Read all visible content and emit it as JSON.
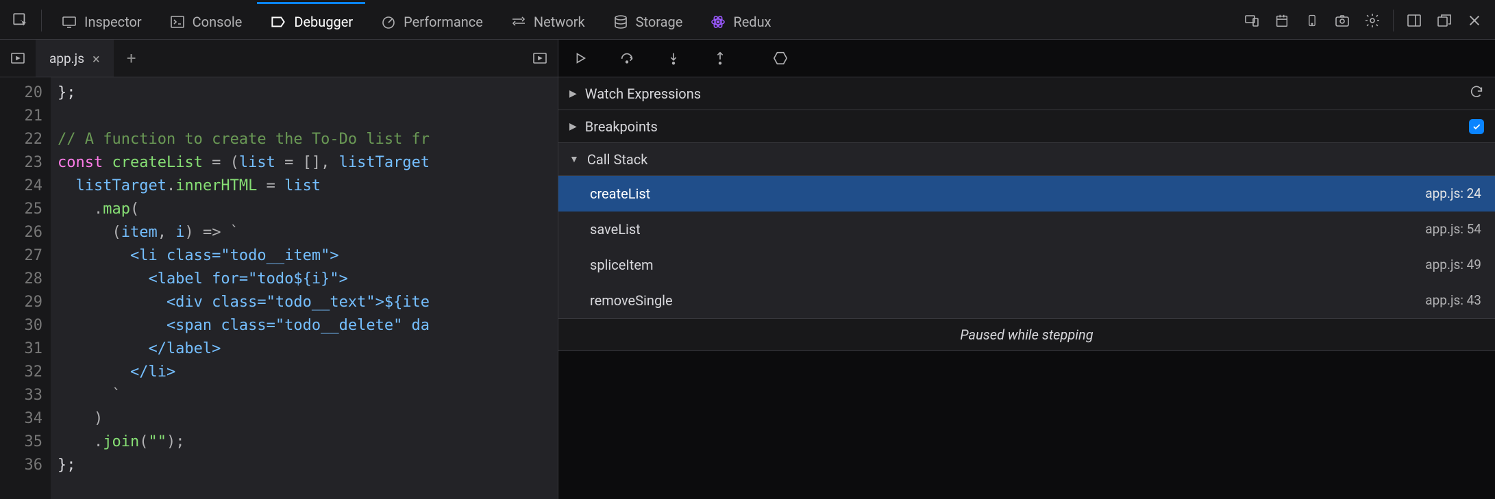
{
  "toolbar": {
    "inspector": "Inspector",
    "console": "Console",
    "debugger": "Debugger",
    "performance": "Performance",
    "network": "Network",
    "storage": "Storage",
    "redux": "Redux"
  },
  "tabs": {
    "file": "app.js"
  },
  "gutter": {
    "start": 20,
    "end": 36
  },
  "code": {
    "l20": "};",
    "l21": "",
    "l22": "// A function to create the To-Do list fr",
    "l23_const": "const ",
    "l23_fn": "createList",
    "l23_eq": " = (",
    "l23_p1": "list",
    "l23_eq2": " = [], ",
    "l23_p2": "listTarget",
    "l24_a": "  ",
    "l24_b": "listTarget",
    "l24_c": ".",
    "l24_d": "innerHTML",
    "l24_e": " = ",
    "l24_f": "list",
    "l25": "    .",
    "l25_fn": "map",
    "l25_b": "(",
    "l26": "      (",
    "l26_i": "item",
    "l26_c": ", ",
    "l26_j": "i",
    "l26_d": ") => `",
    "l27": "        <li class=\"todo__item\">",
    "l28": "          <label for=\"todo${i}\">",
    "l29": "            <div class=\"todo__text\">${ite",
    "l30": "            <span class=\"todo__delete\" da",
    "l31": "          </label>",
    "l32": "        </li>",
    "l33": "      `",
    "l34": "    )",
    "l35": "    .",
    "l35_fn": "join",
    "l35_b": "(",
    "l35_s": "\"\"",
    "l35_c": ");",
    "l36": "};"
  },
  "panels": {
    "watch": "Watch Expressions",
    "breakpoints": "Breakpoints",
    "callstack": "Call Stack"
  },
  "callstack": [
    {
      "fn": "createList",
      "loc": "app.js: 24",
      "selected": true
    },
    {
      "fn": "saveList",
      "loc": "app.js: 54"
    },
    {
      "fn": "spliceItem",
      "loc": "app.js: 49"
    },
    {
      "fn": "removeSingle",
      "loc": "app.js: 43"
    }
  ],
  "status": "Paused while stepping"
}
